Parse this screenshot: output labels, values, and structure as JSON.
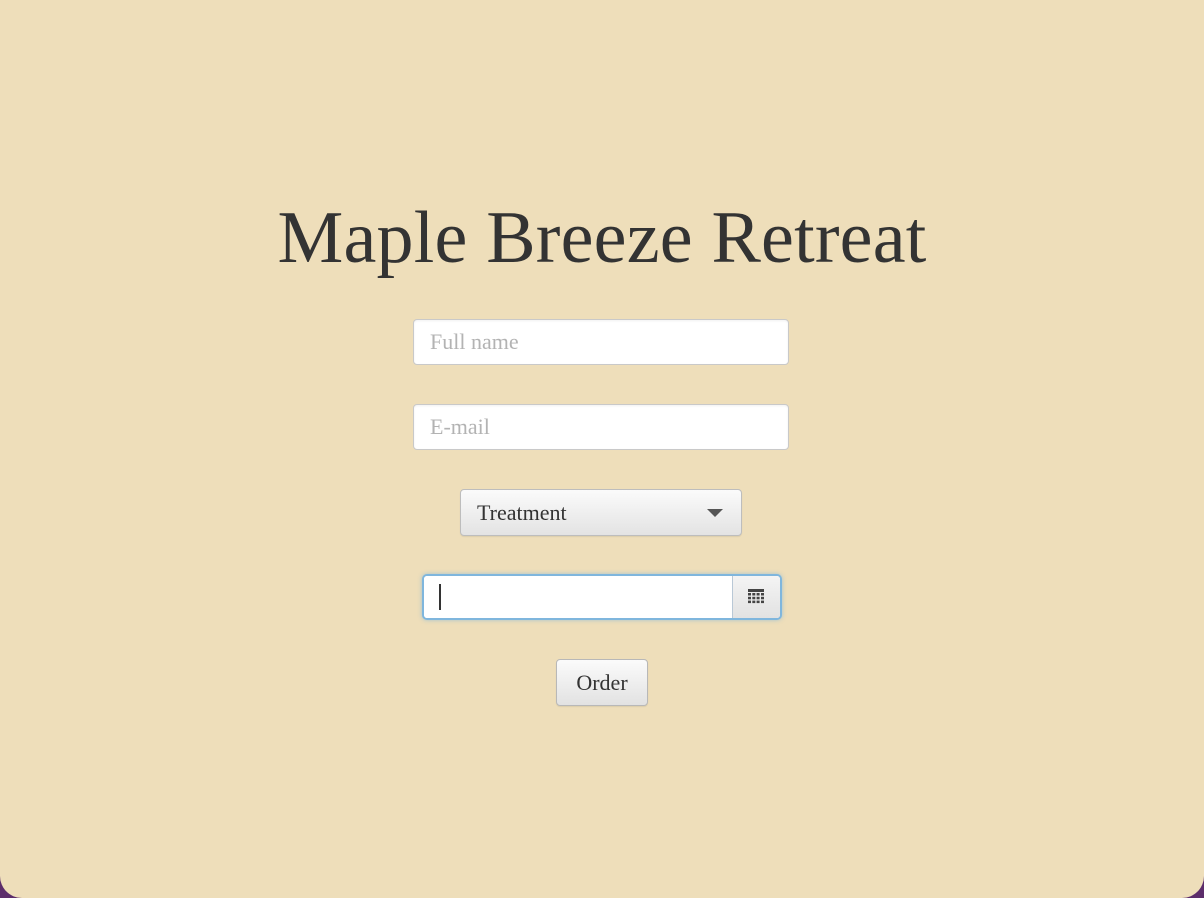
{
  "app": {
    "title": "Maple Breeze Retreat"
  },
  "form": {
    "full_name": {
      "value": "",
      "placeholder": "Full name"
    },
    "email": {
      "value": "",
      "placeholder": "E-mail"
    },
    "treatment": {
      "selected": "Treatment"
    },
    "date": {
      "value": "",
      "icon": "calendar-icon"
    },
    "order_label": "Order"
  },
  "colors": {
    "background": "#eedeba",
    "outer_frame": "#5c2d6b",
    "title_text": "#333333",
    "focus_border": "#7fb6dd"
  }
}
